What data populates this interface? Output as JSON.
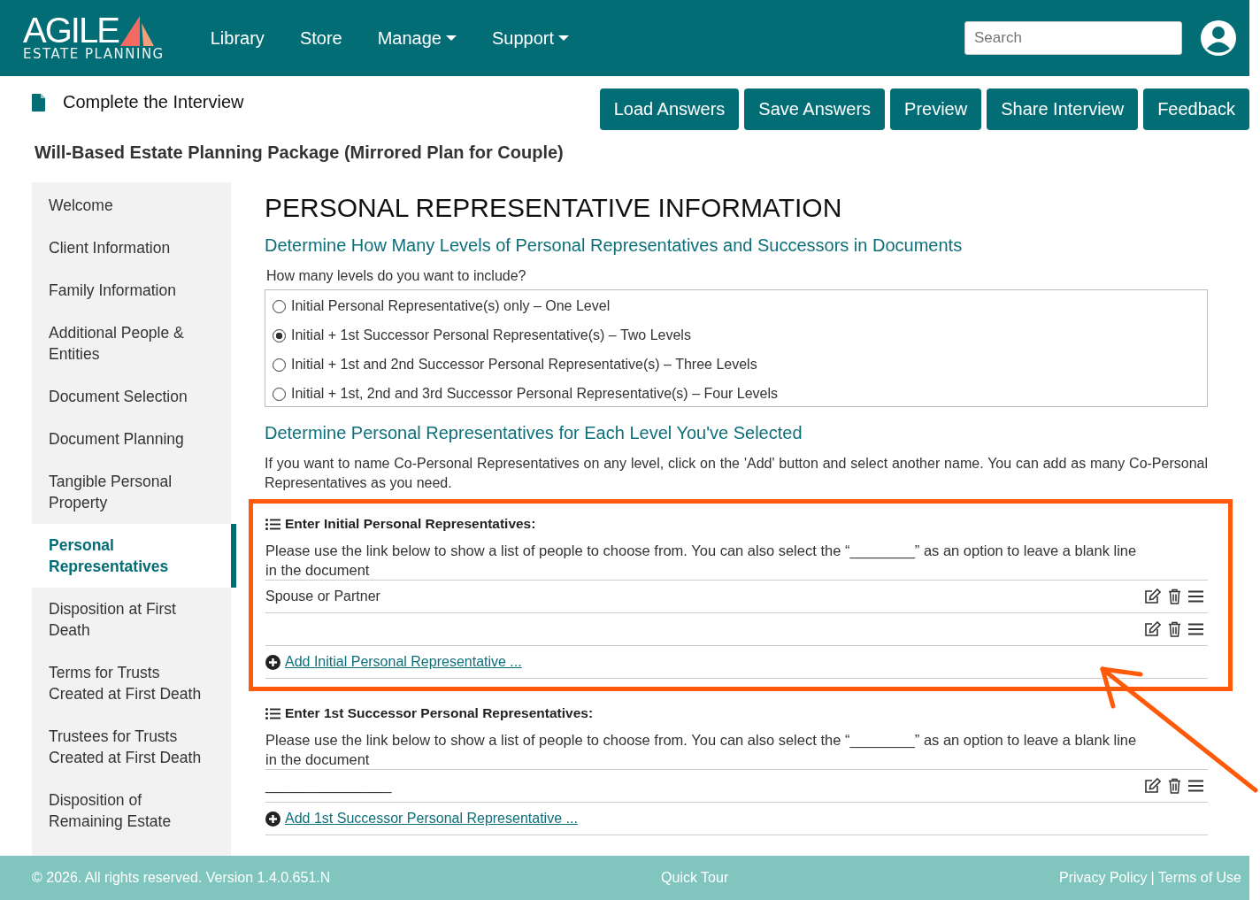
{
  "navbar": {
    "logo_word": "AGILE",
    "logo_sub": "ESTATE PLANNING",
    "links": [
      {
        "label": "Library",
        "dropdown": false
      },
      {
        "label": "Store",
        "dropdown": false
      },
      {
        "label": "Manage",
        "dropdown": true
      },
      {
        "label": "Support",
        "dropdown": true
      }
    ],
    "search": {
      "placeholder": "Search"
    }
  },
  "toolbar": {
    "title": "Complete the Interview",
    "buttons": [
      "Load Answers",
      "Save Answers",
      "Preview",
      "Share Interview",
      "Feedback"
    ]
  },
  "package_title": "Will-Based Estate Planning Package (Mirrored Plan for Couple)",
  "sidebar": {
    "items": [
      {
        "label": "Welcome",
        "selected": false
      },
      {
        "label": "Client Information",
        "selected": false
      },
      {
        "label": "Family Information",
        "selected": false
      },
      {
        "label": "Additional People & Entities",
        "selected": false
      },
      {
        "label": "Document Selection",
        "selected": false
      },
      {
        "label": "Document Planning",
        "selected": false
      },
      {
        "label": "Tangible Personal Property",
        "selected": false
      },
      {
        "label": "Personal Representatives",
        "selected": true
      },
      {
        "label": "Disposition at First Death",
        "selected": false
      },
      {
        "label": "Terms for Trusts Created at First Death",
        "selected": false
      },
      {
        "label": "Trustees for Trusts Created at First Death",
        "selected": false
      },
      {
        "label": "Disposition of Remaining Estate",
        "selected": false
      }
    ]
  },
  "page_heading": "PERSONAL REPRESENTATIVE INFORMATION",
  "levels": {
    "heading": "Determine How Many Levels of Personal Representatives and Successors in Documents",
    "question": "How many levels do you want to include?",
    "options": [
      {
        "label": "Initial Personal Representative(s) only – One Level",
        "selected": false
      },
      {
        "label": "Initial + 1st Successor Personal Representative(s) – Two Levels",
        "selected": true
      },
      {
        "label": "Initial + 1st and 2nd Successor Personal Representative(s) – Three Levels",
        "selected": false
      },
      {
        "label": "Initial + 1st, 2nd and 3rd Successor Personal Representative(s) – Four Levels",
        "selected": false
      }
    ]
  },
  "representatives": {
    "heading": "Determine Personal Representatives for Each Level You've Selected",
    "intro": "If you want to name Co-Personal Representatives on any level, click on the 'Add' button and select another name. You can add as many Co-Personal Representatives as you need.",
    "groups": [
      {
        "title": "Enter Initial Personal Representatives:",
        "help": "Please use the link below to show a list of people to choose from. You can also select the “________” as an option to leave a blank line in the document",
        "highlighted": true,
        "rows": [
          "Spouse or Partner",
          ""
        ],
        "add_link": "Add Initial Personal Representative ..."
      },
      {
        "title": "Enter 1st Successor Personal Representatives:",
        "help": "Please use the link below to show a list of people to choose from. You can also select the “________” as an option to leave a blank line in the document",
        "highlighted": false,
        "rows": [
          "________________"
        ],
        "add_link": "Add 1st Successor Personal Representative ..."
      }
    ]
  },
  "footer": {
    "copyright": "© 2026. All rights reserved. Version 1.4.0.651.N",
    "center_link": "Quick Tour",
    "links": [
      "Privacy Policy",
      "Terms of Use"
    ],
    "separator": "|"
  }
}
